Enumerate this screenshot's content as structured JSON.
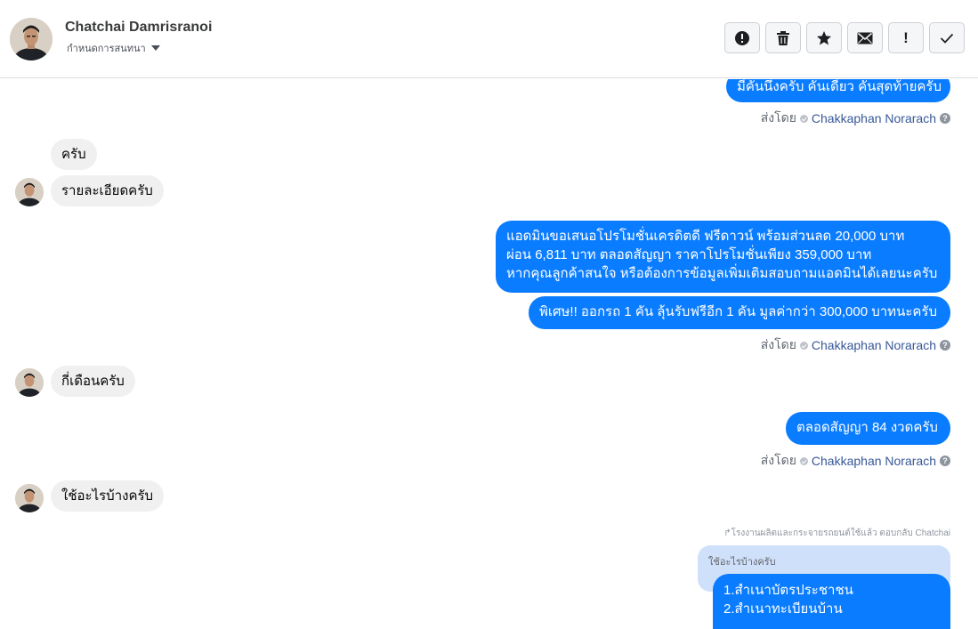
{
  "contact": {
    "name": "Chatchai Damrisranoi",
    "subtitle": "กำหนดการสนทนา"
  },
  "toolbar": {
    "buttons": [
      {
        "icon": "alert-circle-icon"
      },
      {
        "icon": "trash-icon"
      },
      {
        "icon": "star-icon"
      },
      {
        "icon": "envelope-icon"
      },
      {
        "icon": "exclamation-icon"
      },
      {
        "icon": "checkmark-icon"
      }
    ],
    "exclamation_glyph": "!"
  },
  "messages": {
    "out1": "มีคันนึงครับ คันเดียว คันสุดท้ายครับ",
    "in1a": "ครับ",
    "in1b": "รายละเอียดครับ",
    "out2_line1": "แอดมินขอเสนอโปรโมชั่นเครดิตดี ฟรีดาวน์ พร้อมส่วนลด 20,000 บาท",
    "out2_line2": "ผ่อน 6,811 บาท ตลอดสัญญา ราคาโปรโมชั่นเพียง 359,000 บาท",
    "out2_line3": "หากคุณลูกค้าสนใจ หรือต้องการข้อมูลเพิ่มเติมสอบถามแอดมินได้เลยนะครับ",
    "out3": "พิเศษ!! ออกรถ 1 คัน ลุ้นรับฟรีอีก 1 คัน มูลค่ากว่า 300,000 บาทนะครับ",
    "in2": "กี่เดือนครับ",
    "out4": "ตลอดสัญญา 84 งวดครับ",
    "in3": "ใช้อะไรบ้างครับ",
    "reply_note": "โรงงานผลิตและกระจายรถยนต์ใช้แล้ว ตอบกลับ Chatchai",
    "quoted": "ใช้อะไรบ้างครับ",
    "reply_line1": "1.สำเนาบัตรประชาชน",
    "reply_line2": "2.สำเนาทะเบียนบ้าน"
  },
  "sent_by": {
    "prefix": "ส่งโดย",
    "agent": "Chakkaphan Norarach",
    "help": "?"
  },
  "colors": {
    "outgoing_bubble": "#0a7cff",
    "incoming_bubble": "#f0f0f0",
    "quoted_bubble": "#cfe0fa",
    "agent_link": "#385898"
  }
}
